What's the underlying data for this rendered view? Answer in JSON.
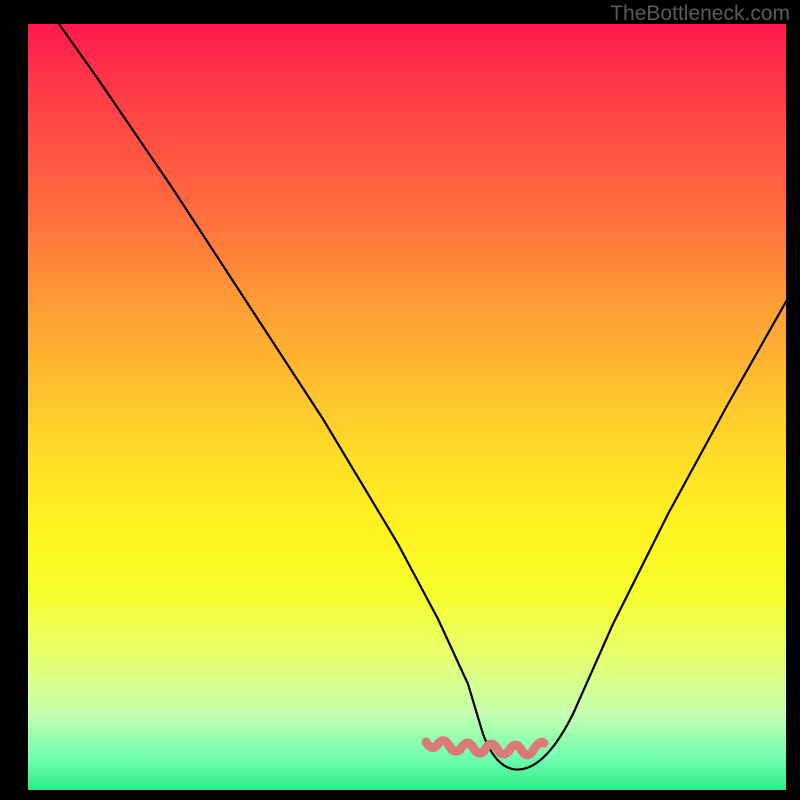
{
  "watermark": "TheBottleneck.com",
  "chart_data": {
    "type": "line",
    "title": "",
    "xlabel": "",
    "ylabel": "",
    "xlim": [
      0,
      100
    ],
    "ylim": [
      0,
      100
    ],
    "grid": false,
    "legend": false,
    "series": [
      {
        "name": "bottleneck-curve",
        "x": [
          0,
          10,
          20,
          30,
          40,
          50,
          55,
          58,
          60,
          63,
          67,
          70,
          75,
          82,
          90,
          100
        ],
        "values": [
          100,
          82,
          64,
          46,
          28,
          10,
          3,
          1,
          0,
          0,
          1,
          3,
          10,
          23,
          40,
          62
        ]
      },
      {
        "name": "trough-marker",
        "x": [
          52,
          55,
          58,
          61,
          64,
          67,
          70
        ],
        "values": [
          3.2,
          1.8,
          1.2,
          1.0,
          1.1,
          1.7,
          3.0
        ]
      }
    ],
    "colors": {
      "curve": "#000000",
      "trough": "#dc7a78",
      "gradient_top": "#ff1a4d",
      "gradient_bottom": "#30e885"
    }
  }
}
